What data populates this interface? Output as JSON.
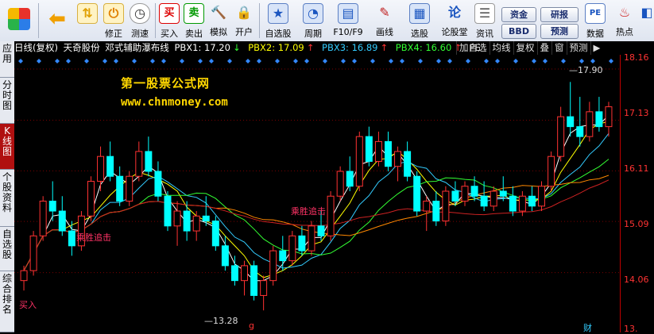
{
  "toolbar": {
    "buttons": [
      {
        "label": ""
      },
      {
        "label": ""
      },
      {
        "label": "修正"
      },
      {
        "label": "测速"
      },
      {
        "label": "买入"
      },
      {
        "label": "卖出"
      },
      {
        "label": "模拟"
      },
      {
        "label": "开户"
      },
      {
        "label": "自选股"
      },
      {
        "label": "周期"
      },
      {
        "label": "F10/F9"
      },
      {
        "label": "画线"
      },
      {
        "label": "选股"
      },
      {
        "label": "论股堂"
      },
      {
        "label": "资讯"
      },
      {
        "label": "数据"
      },
      {
        "label": "热点"
      }
    ],
    "pills": [
      "资金",
      "研报",
      "BBD",
      "预测"
    ],
    "icon_glyphs": {
      "buy": "买",
      "sell": "卖",
      "discuss": "论",
      "data": "PE"
    }
  },
  "side_tabs": [
    "应用",
    "分时图",
    "K线图",
    "个股资料",
    "自选股",
    "综合排名"
  ],
  "chart": {
    "period": "日线(复权)",
    "stock_name": "天奇股份",
    "indicator_name": "邓式辅助瀑布线",
    "pbx": [
      {
        "label": "PBX1: 17.20",
        "arrow": "↓",
        "color": "#ffffff"
      },
      {
        "label": "PBX2: 17.09",
        "arrow": "↑",
        "color": "#ffff00"
      },
      {
        "label": "PBX3: 16.89",
        "arrow": "↑",
        "color": "#33ccff"
      },
      {
        "label": "PBX4: 16.60",
        "arrow": "↑",
        "color": "#33ff33"
      },
      {
        "label": "PE",
        "arrow": "",
        "color": "#cccccc"
      }
    ],
    "right_buttons": [
      "加自选",
      "均线",
      "复权",
      "叠",
      "窗",
      "预测",
      "▶"
    ],
    "axis_labels": [
      "18.16",
      "17.13",
      "16.11",
      "15.09",
      "14.06",
      "13."
    ],
    "high_label": "17.90",
    "low_label": "13.28",
    "signals": [
      "乘胜追击",
      "乘胜追击",
      "买入"
    ],
    "bottom_marks": [
      "g",
      "财"
    ],
    "watermark_title": "第一股票公式网",
    "watermark_url": "www.chnmoney.com"
  },
  "chart_data": {
    "type": "candlestick",
    "ylim": [
      13.0,
      18.4
    ],
    "ticks": [
      18.16,
      17.13,
      16.11,
      15.09,
      14.06
    ],
    "candles": [
      [
        13.9,
        14.2,
        13.7,
        14.1
      ],
      [
        14.1,
        14.9,
        14.0,
        14.8
      ],
      [
        14.8,
        15.6,
        14.7,
        15.5
      ],
      [
        15.5,
        15.9,
        15.1,
        15.3
      ],
      [
        15.3,
        15.6,
        14.8,
        14.9
      ],
      [
        14.9,
        15.1,
        14.4,
        14.6
      ],
      [
        14.6,
        15.3,
        14.5,
        15.2
      ],
      [
        15.2,
        16.0,
        15.1,
        15.9
      ],
      [
        15.9,
        16.6,
        15.7,
        16.4
      ],
      [
        16.4,
        16.7,
        15.9,
        16.0
      ],
      [
        16.0,
        16.2,
        15.4,
        15.5
      ],
      [
        15.5,
        16.1,
        15.4,
        16.0
      ],
      [
        16.0,
        16.7,
        15.9,
        16.5
      ],
      [
        16.5,
        16.8,
        16.0,
        16.1
      ],
      [
        16.1,
        16.3,
        15.5,
        15.6
      ],
      [
        15.6,
        15.7,
        14.9,
        15.0
      ],
      [
        15.0,
        15.5,
        14.6,
        15.3
      ],
      [
        15.3,
        15.5,
        14.7,
        14.9
      ],
      [
        14.9,
        15.3,
        14.7,
        15.2
      ],
      [
        15.2,
        15.6,
        15.0,
        15.1
      ],
      [
        15.1,
        15.2,
        14.5,
        14.6
      ],
      [
        14.6,
        14.8,
        14.1,
        14.2
      ],
      [
        14.2,
        14.4,
        13.8,
        13.9
      ],
      [
        13.9,
        14.3,
        13.6,
        14.2
      ],
      [
        14.2,
        14.3,
        13.5,
        13.6
      ],
      [
        13.6,
        14.0,
        13.3,
        13.9
      ],
      [
        13.9,
        14.6,
        13.8,
        14.5
      ],
      [
        14.5,
        14.8,
        14.1,
        14.3
      ],
      [
        14.3,
        14.9,
        14.2,
        14.8
      ],
      [
        14.8,
        15.0,
        14.4,
        14.5
      ],
      [
        14.5,
        15.1,
        14.4,
        15.0
      ],
      [
        15.0,
        15.3,
        14.7,
        14.8
      ],
      [
        14.8,
        15.7,
        14.7,
        15.6
      ],
      [
        15.6,
        16.2,
        15.5,
        16.1
      ],
      [
        16.1,
        16.4,
        15.7,
        15.8
      ],
      [
        15.8,
        16.9,
        15.7,
        16.8
      ],
      [
        16.8,
        17.0,
        16.2,
        16.3
      ],
      [
        16.3,
        16.9,
        16.2,
        16.7
      ],
      [
        16.7,
        16.9,
        16.1,
        16.2
      ],
      [
        16.2,
        16.6,
        15.9,
        16.5
      ],
      [
        16.5,
        16.7,
        15.9,
        16.0
      ],
      [
        16.0,
        16.1,
        15.2,
        15.3
      ],
      [
        15.3,
        15.6,
        14.9,
        15.5
      ],
      [
        15.5,
        15.7,
        15.0,
        15.1
      ],
      [
        15.1,
        15.8,
        15.0,
        15.7
      ],
      [
        15.7,
        15.9,
        15.4,
        15.5
      ],
      [
        15.5,
        15.9,
        15.4,
        15.8
      ],
      [
        15.8,
        16.0,
        15.5,
        15.6
      ],
      [
        15.6,
        15.9,
        15.3,
        15.4
      ],
      [
        15.4,
        15.8,
        15.3,
        15.7
      ],
      [
        15.7,
        16.0,
        15.5,
        15.6
      ],
      [
        15.6,
        15.8,
        15.2,
        15.3
      ],
      [
        15.3,
        15.7,
        15.2,
        15.6
      ],
      [
        15.6,
        15.8,
        15.3,
        15.4
      ],
      [
        15.4,
        15.9,
        15.3,
        15.8
      ],
      [
        15.8,
        16.5,
        15.7,
        16.4
      ],
      [
        16.4,
        17.4,
        16.3,
        17.2
      ],
      [
        17.2,
        17.9,
        16.8,
        17.0
      ],
      [
        17.0,
        17.6,
        16.6,
        16.8
      ],
      [
        16.8,
        17.5,
        16.7,
        17.3
      ],
      [
        17.3,
        17.6,
        16.9,
        17.0
      ],
      [
        17.0,
        17.5,
        16.8,
        17.4
      ]
    ]
  }
}
